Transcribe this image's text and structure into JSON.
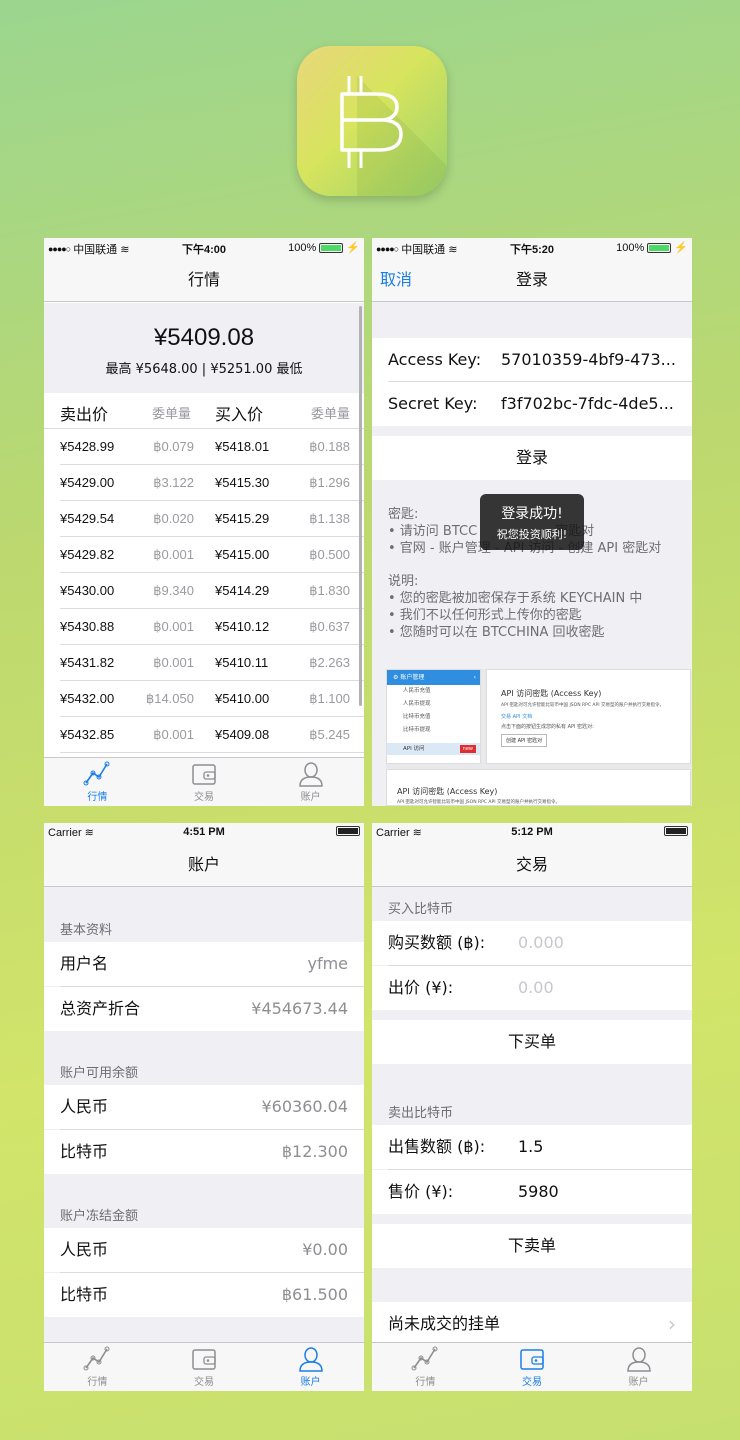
{
  "app_icon": {
    "name": "bitcoin-icon",
    "glyph": "B"
  },
  "screen1": {
    "status": {
      "carrier": "中国联通",
      "time": "下午4:00",
      "battery": "100%"
    },
    "title": "行情",
    "price": "¥5409.08",
    "range": "最高 ¥5648.00 | ¥5251.00 最低",
    "headers": {
      "sell_price": "卖出价",
      "sell_qty": "委单量",
      "buy_price": "买入价",
      "buy_qty": "委单量"
    },
    "rows": [
      {
        "sp": "¥5428.99",
        "sq": "฿0.079",
        "bp": "¥5418.01",
        "bq": "฿0.188"
      },
      {
        "sp": "¥5429.00",
        "sq": "฿3.122",
        "bp": "¥5415.30",
        "bq": "฿1.296"
      },
      {
        "sp": "¥5429.54",
        "sq": "฿0.020",
        "bp": "¥5415.29",
        "bq": "฿1.138"
      },
      {
        "sp": "¥5429.82",
        "sq": "฿0.001",
        "bp": "¥5415.00",
        "bq": "฿0.500"
      },
      {
        "sp": "¥5430.00",
        "sq": "฿9.340",
        "bp": "¥5414.29",
        "bq": "฿1.830"
      },
      {
        "sp": "¥5430.88",
        "sq": "฿0.001",
        "bp": "¥5410.12",
        "bq": "฿0.637"
      },
      {
        "sp": "¥5431.82",
        "sq": "฿0.001",
        "bp": "¥5410.11",
        "bq": "฿2.263"
      },
      {
        "sp": "¥5432.00",
        "sq": "฿14.050",
        "bp": "¥5410.00",
        "bq": "฿1.100"
      },
      {
        "sp": "¥5432.85",
        "sq": "฿0.001",
        "bp": "¥5409.08",
        "bq": "฿5.245"
      }
    ]
  },
  "tabs": {
    "market": "行情",
    "trade": "交易",
    "account": "账户"
  },
  "screen2": {
    "status": {
      "carrier": "中国联通",
      "time": "下午5:20",
      "battery": "100%"
    },
    "cancel": "取消",
    "title": "登录",
    "access_key_label": "Access Key:",
    "access_key_value": "57010359-4bf9-473...",
    "secret_key_label": "Secret Key:",
    "secret_key_value": "f3f702bc-7fdc-4de5...",
    "login_button": "登录",
    "toast_title": "登录成功!",
    "toast_sub": "祝您投资顺利!",
    "help1": [
      "密匙:",
      "• 请访问 BTCC",
      "密匙对",
      "• 官网 - 账户管理 - API 访问 - 创建 API 密匙对"
    ],
    "help2": [
      "说明:",
      "• 您的密匙被加密保存于系统 KEYCHAIN 中",
      "• 我们不以任何形式上传你的密匙",
      "• 您随时可以在 BTCCHINA 回收密匙"
    ],
    "shot": {
      "menu_title": "账户管理",
      "menu_items": [
        "人民币充值",
        "人民币提现",
        "比特币充值",
        "比特币提现",
        "API 访问"
      ],
      "new_badge": "new",
      "panel_title": "API 访问密匙 (Access Key)",
      "panel_desc": "API 密匙对可允许智能比较币中国 JSON RPC API 交易型的账户并执行交易指令。",
      "panel_link": "交易 API 文档",
      "panel_note": "点击下面的按钮生成您的私有 API 密匙对:",
      "panel_button": "创建 API 密匙对",
      "panel2_title": "API 访问密匙 (Access Key)",
      "panel2_desc": "API 密匙对可允许智能比较币中国 JSON RPC API 交易型的账户并执行交易指令。"
    }
  },
  "screen3": {
    "status": {
      "carrier": "Carrier",
      "time": "4:51 PM"
    },
    "title": "账户",
    "sec1": "基本资料",
    "username_label": "用户名",
    "username": "yfme",
    "total_label": "总资产折合",
    "total": "¥454673.44",
    "sec2": "账户可用余额",
    "cny_label": "人民币",
    "cny": "¥60360.04",
    "btc_label": "比特币",
    "btc": "฿12.300",
    "sec3": "账户冻结金额",
    "fcny_label": "人民币",
    "fcny": "¥0.00",
    "fbtc_label": "比特币",
    "fbtc": "฿61.500"
  },
  "screen4": {
    "status": {
      "carrier": "Carrier",
      "time": "5:12 PM"
    },
    "title": "交易",
    "buy_section": "买入比特币",
    "buy_amount_label": "购买数额 (฿):",
    "buy_amount_placeholder": "0.000",
    "buy_price_label": "出价 (¥):",
    "buy_price_placeholder": "0.00",
    "buy_button": "下买单",
    "sell_section": "卖出比特币",
    "sell_amount_label": "出售数额 (฿):",
    "sell_amount": "1.5",
    "sell_price_label": "售价 (¥):",
    "sell_price": "5980",
    "sell_button": "下卖单",
    "open_orders": "尚未成交的挂单"
  },
  "colors": {
    "accent": "#1a7ee8",
    "battery_green": "#4cd964"
  }
}
